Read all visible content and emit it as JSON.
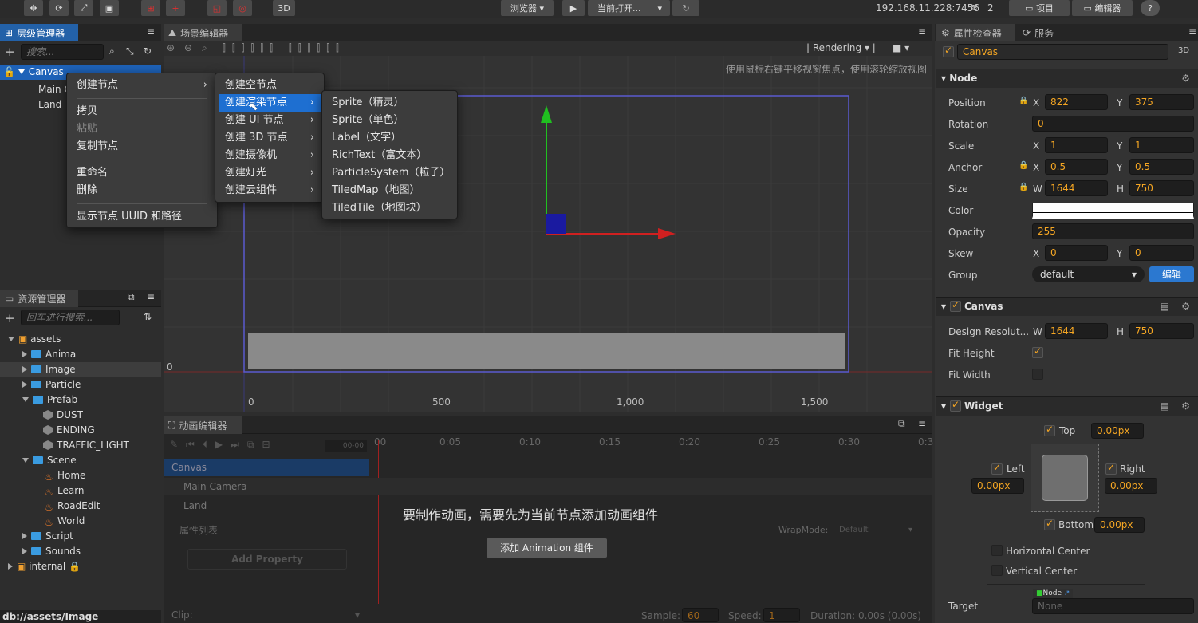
{
  "toolbar": {
    "preview_label": "浏览器",
    "current_open_label": "当前打开...",
    "mode_3d": "3D",
    "ip": "192.168.11.228:7456",
    "wifi_count": "2",
    "project_label": "项目",
    "editor_label": "编辑器"
  },
  "hierarchy": {
    "title": "层级管理器",
    "search_placeholder": "搜索...",
    "nodes": [
      "Canvas",
      "Main C",
      "Land"
    ]
  },
  "context_menu": {
    "items": [
      "创建节点",
      "拷贝",
      "粘贴",
      "复制节点",
      "重命名",
      "删除",
      "显示节点 UUID 和路径"
    ]
  },
  "create_submenu": {
    "items": [
      "创建空节点",
      "创建渲染节点",
      "创建 UI 节点",
      "创建 3D 节点",
      "创建摄像机",
      "创建灯光",
      "创建云组件"
    ]
  },
  "render_submenu": {
    "items": [
      "Sprite（精灵）",
      "Sprite（单色）",
      "Label（文字）",
      "RichText（富文本）",
      "ParticleSystem（粒子）",
      "TiledMap（地图）",
      "TiledTile（地图块）"
    ]
  },
  "scene": {
    "title": "场景编辑器",
    "rendering": "Rendering",
    "hint": "使用鼠标右键平移视窗焦点，使用滚轮缩放视图",
    "y0": "0",
    "x_ticks": [
      "0",
      "500",
      "1,000",
      "1,500"
    ]
  },
  "assets": {
    "title": "资源管理器",
    "search_placeholder": "回车进行搜索...",
    "root": "assets",
    "items": [
      "Anima",
      "Image",
      "Particle",
      "Prefab",
      "DUST",
      "ENDING",
      "TRAFFIC_LIGHT",
      "Scene",
      "Home",
      "Learn",
      "RoadEdit",
      "World",
      "Script",
      "Sounds"
    ],
    "internal": "internal",
    "path": "db://assets/Image"
  },
  "animation": {
    "title": "动画编辑器",
    "time_field": "00-00",
    "timeline": [
      "00",
      "0:05",
      "0:10",
      "0:15",
      "0:20",
      "0:25",
      "0:30",
      "0:3"
    ],
    "nodes": [
      "Canvas",
      "Main Camera",
      "Land"
    ],
    "props_label": "属性列表",
    "wrapmode_label": "WrapMode:",
    "wrapmode_value": "Default",
    "add_property": "Add Property",
    "message": "要制作动画，需要先为当前节点添加动画组件",
    "add_anim_button": "添加 Animation 组件",
    "clip_label": "Clip:",
    "sample_label": "Sample:",
    "sample_value": "60",
    "speed_label": "Speed:",
    "speed_value": "1",
    "duration": "Duration: 0.00s (0.00s)"
  },
  "inspector": {
    "title": "属性检查器",
    "service_tab": "服务",
    "node_name": "Canvas",
    "badge_3d": "3D",
    "node_section": "Node",
    "position_label": "Position",
    "pos_x": "822",
    "pos_y": "375",
    "rotation_label": "Rotation",
    "rotation": "0",
    "scale_label": "Scale",
    "scale_x": "1",
    "scale_y": "1",
    "anchor_label": "Anchor",
    "anchor_x": "0.5",
    "anchor_y": "0.5",
    "size_label": "Size",
    "size_w": "1644",
    "size_h": "750",
    "color_label": "Color",
    "opacity_label": "Opacity",
    "opacity": "255",
    "skew_label": "Skew",
    "skew_x": "0",
    "skew_y": "0",
    "group_label": "Group",
    "group_value": "default",
    "edit_button": "编辑",
    "canvas_section": "Canvas",
    "design_label": "Design Resolut...",
    "design_w": "1644",
    "design_h": "750",
    "fit_height_label": "Fit Height",
    "fit_width_label": "Fit Width",
    "widget_section": "Widget",
    "top_label": "Top",
    "top_value": "0.00px",
    "left_label": "Left",
    "left_value": "0.00px",
    "right_label": "Right",
    "right_value": "0.00px",
    "bottom_label": "Bottom",
    "bottom_value": "0.00px",
    "hcenter_label": "Horizontal Center",
    "vcenter_label": "Vertical Center",
    "target_label": "Target",
    "target_tag": "Node",
    "target_value": "None",
    "axis_x": "X",
    "axis_y": "Y",
    "axis_w": "W",
    "axis_h": "H"
  },
  "colors": {
    "accent": "#f5a623",
    "selection": "#1e6fd1",
    "bg": "#2d2d2d"
  }
}
